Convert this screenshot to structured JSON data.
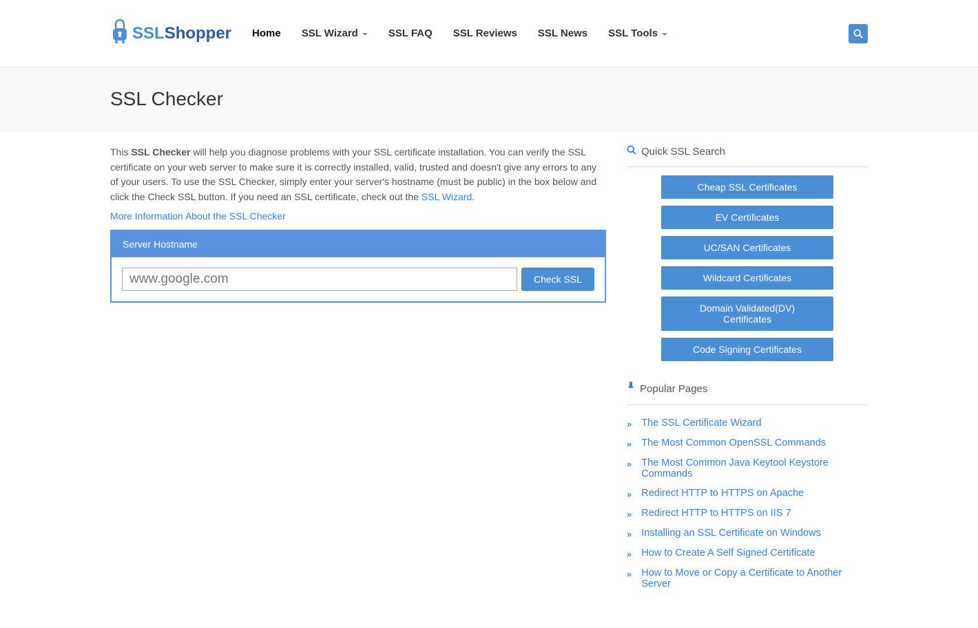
{
  "logo": {
    "part1": "SSL",
    "part2": "Shopper"
  },
  "nav": {
    "home": "Home",
    "wizard": "SSL Wizard",
    "faq": "SSL FAQ",
    "reviews": "SSL Reviews",
    "news": "SSL News",
    "tools": "SSL Tools"
  },
  "page_title": "SSL Checker",
  "intro": {
    "pre": "This ",
    "strong": "SSL Checker",
    "mid": " will help you diagnose problems with your SSL certificate installation. You can verify the SSL certificate on your web server to make sure it is correctly installed, valid, trusted and doesn't give any errors to any of your users. To use the SSL Checker, simply enter your server's hostname (must be public) in the box below and click the Check SSL button. If you need an SSL certificate, check out the ",
    "link": "SSL Wizard",
    "end": "."
  },
  "more_info": "More Information About the SSL Checker",
  "form": {
    "header": "Server Hostname",
    "placeholder": "www.google.com",
    "button": "Check SSL"
  },
  "sidebar": {
    "quick_search": "Quick SSL Search",
    "cert_tags": [
      "Cheap SSL Certificates",
      "EV Certificates",
      "UC/SAN Certificates",
      "Wildcard Certificates",
      "Domain Validated(DV) Certificates",
      "Code Signing Certificates"
    ],
    "popular_pages": "Popular Pages",
    "pop_items": [
      "The SSL Certificate Wizard",
      "The Most Common OpenSSL Commands",
      "The Most Common Java Keytool Keystore Commands",
      "Redirect HTTP to HTTPS on Apache",
      "Redirect HTTP to HTTPS on IIS 7",
      "Installing an SSL Certificate on Windows",
      "How to Create A Self Signed Certificate",
      "How to Move or Copy a Certificate to Another Server"
    ]
  }
}
